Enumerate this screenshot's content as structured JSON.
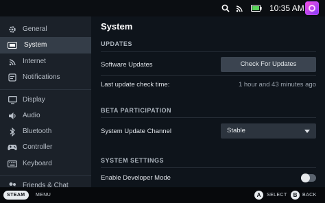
{
  "status_bar": {
    "time": "10:35 AM",
    "icons": [
      "search-icon",
      "wifi-icon",
      "battery-icon",
      "avatar"
    ]
  },
  "sidebar": {
    "items": [
      {
        "label": "General",
        "icon": "gear-icon"
      },
      {
        "label": "System",
        "icon": "system-icon",
        "active": true
      },
      {
        "label": "Internet",
        "icon": "wifi-icon"
      },
      {
        "label": "Notifications",
        "icon": "notification-icon"
      },
      {
        "label": "Display",
        "icon": "display-icon"
      },
      {
        "label": "Audio",
        "icon": "speaker-icon"
      },
      {
        "label": "Bluetooth",
        "icon": "bluetooth-icon"
      },
      {
        "label": "Controller",
        "icon": "controller-icon"
      },
      {
        "label": "Keyboard",
        "icon": "keyboard-icon"
      },
      {
        "label": "Friends & Chat",
        "icon": "friends-icon"
      }
    ]
  },
  "main": {
    "title": "System",
    "updates": {
      "heading": "UPDATES",
      "software_updates_label": "Software Updates",
      "check_button": "Check For Updates",
      "last_check_label": "Last update check time:",
      "last_check_value": "1 hour and 43 minutes ago"
    },
    "beta": {
      "heading": "BETA PARTICIPATION",
      "channel_label": "System Update Channel",
      "channel_value": "Stable"
    },
    "system_settings": {
      "heading": "SYSTEM SETTINGS",
      "dev_mode_label": "Enable Developer Mode",
      "dev_mode_enabled": false
    }
  },
  "bottom_bar": {
    "steam_label": "STEAM",
    "menu_label": "MENU",
    "a_button": "A",
    "select_label": "SELECT",
    "b_button": "B",
    "back_label": "BACK"
  },
  "colors": {
    "background": "#0e141b",
    "sidebar": "#1b2129",
    "sidebar_active": "#343d48",
    "button": "#3b4450",
    "avatar_accent": "#c64bff"
  }
}
